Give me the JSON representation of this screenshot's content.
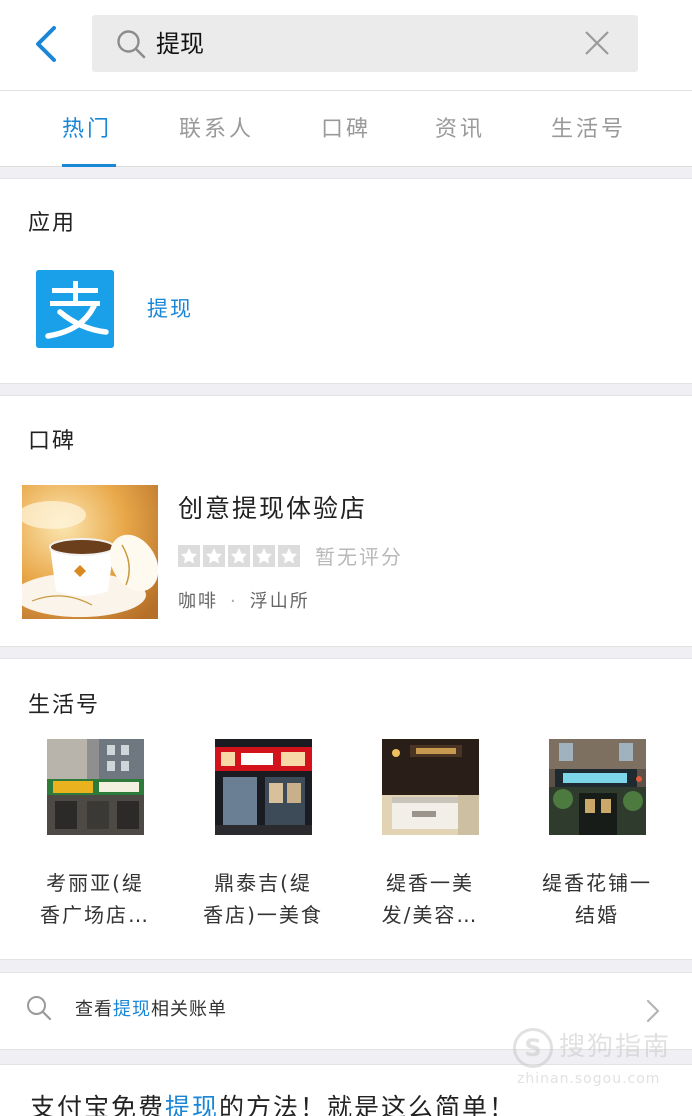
{
  "search": {
    "query": "提现"
  },
  "tabs": [
    {
      "label": "热门",
      "active": true
    },
    {
      "label": "联系人",
      "active": false
    },
    {
      "label": "口碑",
      "active": false
    },
    {
      "label": "资讯",
      "active": false
    },
    {
      "label": "生活号",
      "active": false
    }
  ],
  "apps_section": {
    "title": "应用",
    "app": {
      "name": "提现",
      "logo_char": "支",
      "logo_color": "#1aa0e8"
    }
  },
  "koubei_section": {
    "title": "口碑",
    "shop": {
      "name": "创意提现体验店",
      "rating_stars": 0,
      "rating_text": "暂无评分",
      "category": "咖啡",
      "separator": "·",
      "area": "浮山所"
    }
  },
  "life_section": {
    "title": "生活号",
    "items": [
      {
        "line1": "考丽亚(缇",
        "line2": "香广场店…"
      },
      {
        "line1": "鼎泰吉(缇",
        "line2": "香店)一美食"
      },
      {
        "line1": "缇香一美",
        "line2": "发/美容…"
      },
      {
        "line1": "缇香花铺一",
        "line2": "结婚"
      }
    ]
  },
  "bill_row": {
    "prefix": "查看",
    "highlight": "提现",
    "suffix": "相关账单"
  },
  "article": {
    "prefix": "支付宝免费",
    "highlight": "提现",
    "suffix": "的方法！就是这么简单！"
  },
  "watermark": {
    "logo_char": "S",
    "text": "搜狗指南",
    "domain": "zhinan.sogou.com"
  },
  "colors": {
    "accent": "#1a86d8",
    "background": "#efeff4",
    "muted": "#9a9a9a"
  }
}
